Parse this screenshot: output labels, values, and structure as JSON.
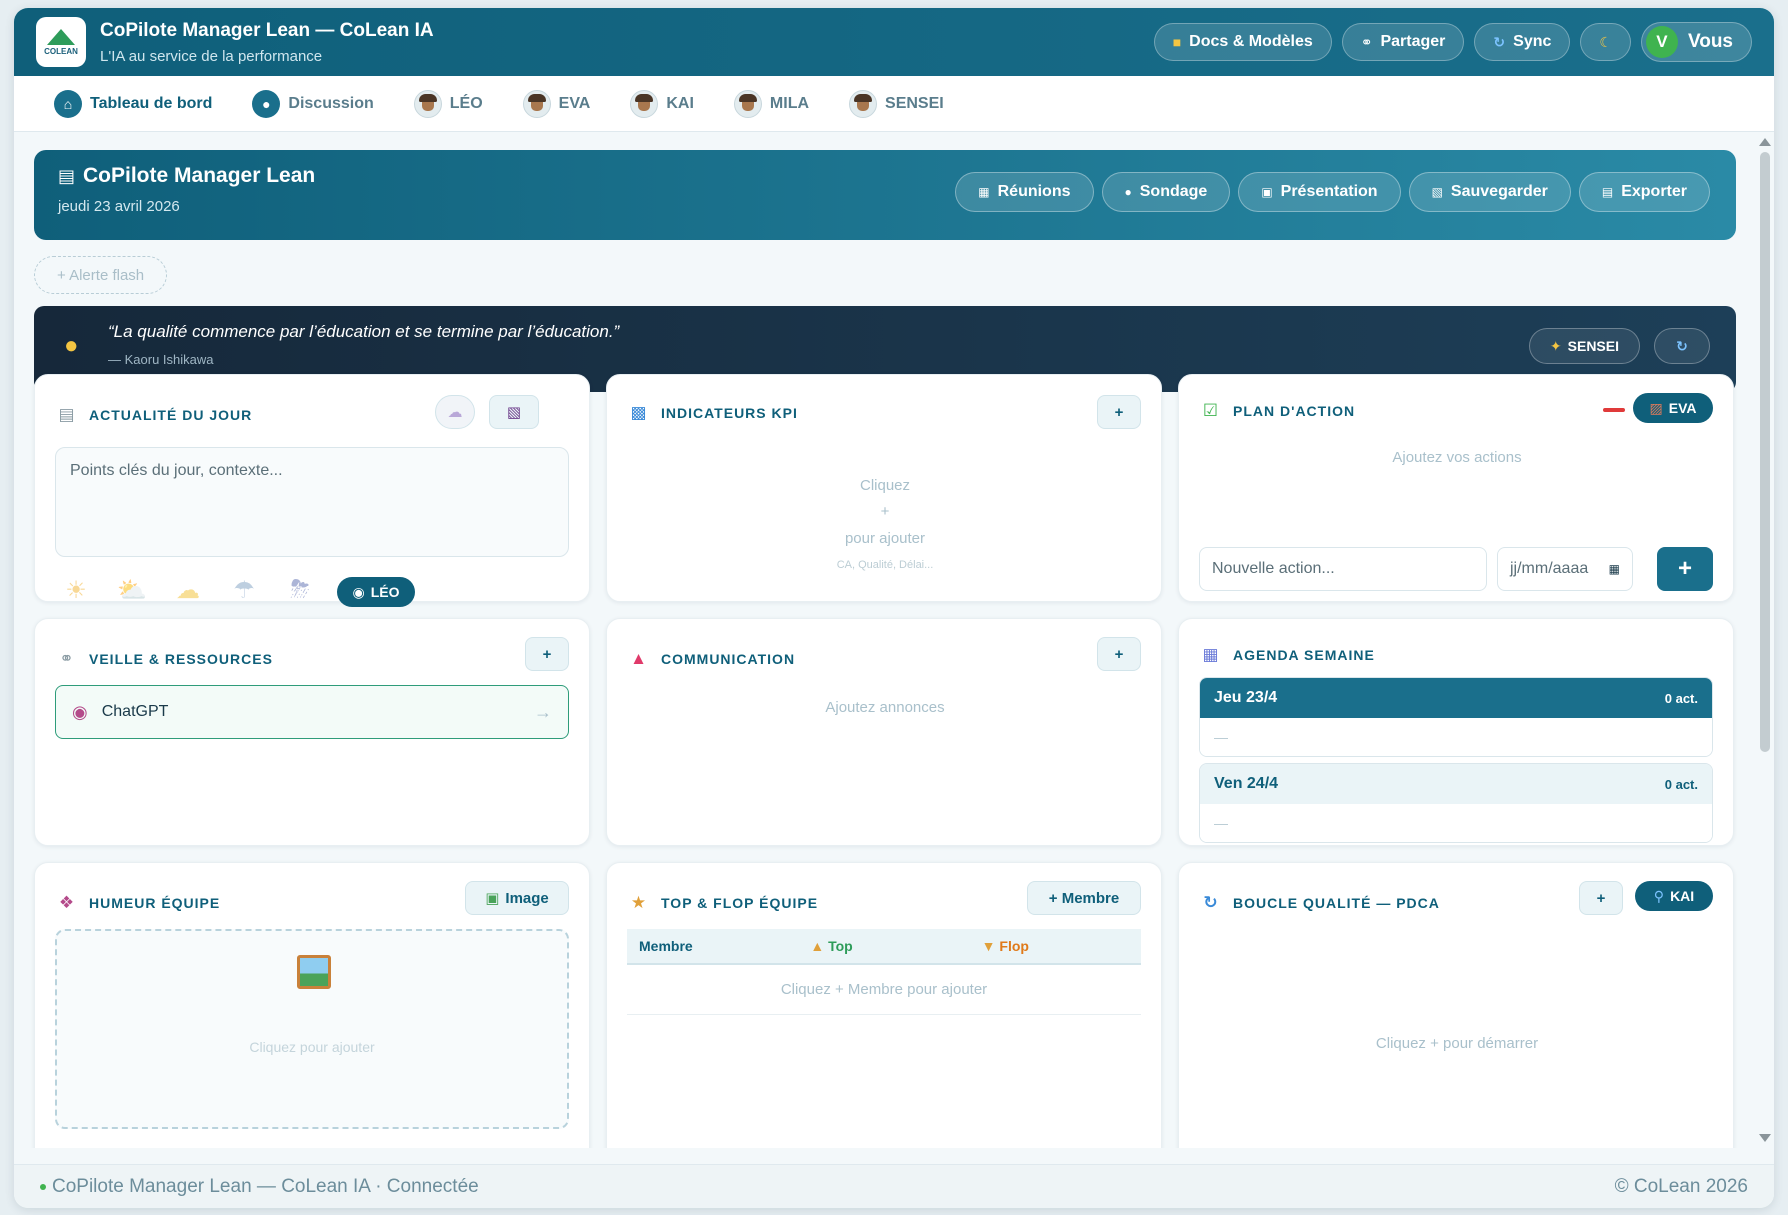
{
  "header": {
    "logo_text": "COLEAN",
    "title": "CoPilote Manager Lean — CoLean IA",
    "subtitle": "L'IA au service de la performance",
    "buttons": {
      "docs": "Docs & Modèles",
      "share": "Partager",
      "sync": "Sync"
    },
    "user_initial": "V",
    "user_label": "Vous"
  },
  "nav": {
    "items": [
      {
        "label": "Tableau de bord"
      },
      {
        "label": "Discussion"
      },
      {
        "label": "LÉO"
      },
      {
        "label": "EVA"
      },
      {
        "label": "KAI"
      },
      {
        "label": "MILA"
      },
      {
        "label": "SENSEI"
      }
    ]
  },
  "hero": {
    "title": "CoPilote Manager Lean",
    "date": "jeudi 23 avril 2026",
    "buttons": {
      "meetings": "Réunions",
      "poll": "Sondage",
      "presentation": "Présentation",
      "save": "Sauvegarder",
      "export": "Exporter"
    }
  },
  "flash": {
    "label": "+ Alerte flash"
  },
  "quote": {
    "text": "“La qualité commence par l’éducation et se termine par l’éducation.”",
    "author": "— Kaoru Ishikawa",
    "sensei_label": "SENSEI"
  },
  "cards": {
    "news": {
      "title": "ACTUALITÉ DU JOUR",
      "placeholder": "Points clés du jour, contexte...",
      "agent": "LÉO"
    },
    "kpi": {
      "title": "INDICATEURS KPI",
      "add": "+",
      "empty_1": "Cliquez",
      "empty_2": "+",
      "empty_3": "pour ajouter",
      "empty_hint": "CA, Qualité, Délai..."
    },
    "plan": {
      "title": "PLAN D'ACTION",
      "agent": "EVA",
      "empty": "Ajoutez vos actions",
      "new_action_placeholder": "Nouvelle action...",
      "date_placeholder": "jj/mm/aaaa",
      "add": "+"
    },
    "veille": {
      "title": "VEILLE & RESSOURCES",
      "add": "+",
      "resource": "ChatGPT"
    },
    "comm": {
      "title": "COMMUNICATION",
      "add": "+",
      "empty": "Ajoutez annonces"
    },
    "agenda": {
      "title": "AGENDA SEMAINE",
      "days": [
        {
          "label": "Jeu 23/4",
          "count": "0 act.",
          "body": "—"
        },
        {
          "label": "Ven 24/4",
          "count": "0 act.",
          "body": "—"
        }
      ]
    },
    "mood": {
      "title": "HUMEUR ÉQUIPE",
      "image_btn": "Image",
      "empty": "Cliquez pour ajouter"
    },
    "topflop": {
      "title": "TOP & FLOP ÉQUIPE",
      "add": "+ Membre",
      "col_member": "Membre",
      "col_top": "Top",
      "col_flop": "Flop",
      "empty": "Cliquez + Membre pour ajouter"
    },
    "pdca": {
      "title": "BOUCLE QUALITÉ — PDCA",
      "add": "+",
      "agent": "KAI",
      "empty": "Cliquez + pour démarrer"
    }
  },
  "footer": {
    "left": "CoPilote Manager Lean — CoLean IA · Connectée",
    "right": "© CoLean 2026"
  },
  "colors": {
    "primary": "#0f5f7a",
    "accent": "#1a6f8c",
    "dark": "#16283a",
    "success": "#3fb34f"
  }
}
